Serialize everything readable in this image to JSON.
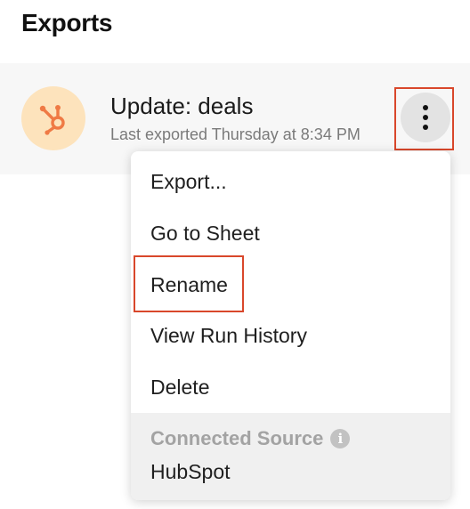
{
  "header": {
    "title": "Exports"
  },
  "export_item": {
    "title": "Update: deals",
    "subtitle": "Last exported Thursday at 8:34 PM",
    "source_icon": "hubspot-icon",
    "icon_color": "#ef7a45",
    "icon_bg": "#fde3bc",
    "more_icon": "kebab-icon"
  },
  "context_menu": {
    "items": [
      {
        "label": "Export..."
      },
      {
        "label": "Go to Sheet"
      },
      {
        "label": "Rename"
      },
      {
        "label": "View Run History"
      },
      {
        "label": "Delete"
      }
    ],
    "footer": {
      "heading": "Connected Source",
      "info_icon": "info-icon",
      "value": "HubSpot"
    }
  },
  "highlight_color": "#d9472b"
}
